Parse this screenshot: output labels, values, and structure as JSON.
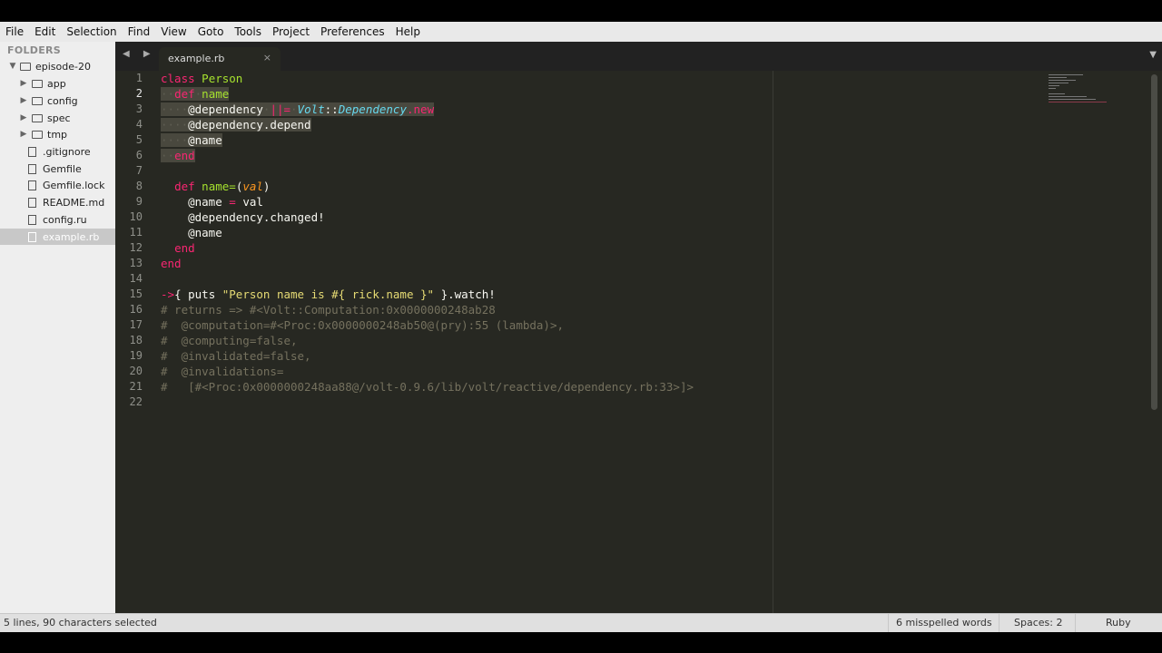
{
  "menu": [
    "File",
    "Edit",
    "Selection",
    "Find",
    "View",
    "Goto",
    "Tools",
    "Project",
    "Preferences",
    "Help"
  ],
  "sidebar": {
    "title": "FOLDERS",
    "root": "episode-20",
    "folders": [
      "app",
      "config",
      "spec",
      "tmp"
    ],
    "files": [
      ".gitignore",
      "Gemfile",
      "Gemfile.lock",
      "README.md",
      "config.ru",
      "example.rb"
    ],
    "selected_file": "example.rb"
  },
  "tab": {
    "name": "example.rb",
    "close": "×"
  },
  "tab_nav": "◀ ▶",
  "editor": {
    "line_numbers": [
      "1",
      "2",
      "3",
      "4",
      "5",
      "6",
      "7",
      "8",
      "9",
      "10",
      "11",
      "12",
      "13",
      "14",
      "15",
      "16",
      "17",
      "18",
      "19",
      "20",
      "21",
      "22"
    ],
    "current_line": "2",
    "line2_kw": "def",
    "line2_name": "name",
    "line3_ivar": "@dependency",
    "line3_op": "||=",
    "line3_cls1": "Volt",
    "line3_sep": "::",
    "line3_cls2": "Dependency",
    "line3_dot": ".",
    "line3_new": "new",
    "line4_code": "@dependency.depend",
    "line5_code": "@name",
    "line6_kw": "end",
    "line8_kw": "def",
    "line8_name": "name=",
    "line8_p1": "(",
    "line8_param": "val",
    "line8_p2": ")",
    "line9_ivar": "@name",
    "line9_op": "=",
    "line9_val": "val",
    "line10_code": "@dependency.changed!",
    "line11_code": "@name",
    "line12_kw": "end",
    "line13_kw": "end",
    "line15_arrow": "->",
    "line15_a": "{ puts ",
    "line15_str": "\"Person name is #{ rick.name }\"",
    "line15_b": " }.watch!",
    "line16": "# returns => #<Volt::Computation:0x0000000248ab28",
    "line17": "#  @computation=#<Proc:0x0000000248ab50@(pry):55 (lambda)>,",
    "line18": "#  @computing=false,",
    "line19": "#  @invalidated=false,",
    "line20": "#  @invalidations=",
    "line21": "#   [#<Proc:0x0000000248aa88@/volt-0.9.6/lib/volt/reactive/dependency.rb:33>]>"
  },
  "class_line": {
    "kw": "class",
    "name": "Person"
  },
  "status": {
    "selection": "5 lines, 90 characters selected",
    "spelling": "6 misspelled words",
    "indent": "Spaces: 2",
    "syntax": "Ruby"
  },
  "colors": {
    "keyword": "#f92672",
    "entity": "#a6e22e",
    "class": "#66d9ef",
    "string": "#e6db74",
    "comment": "#75715e",
    "param": "#fd971f",
    "background": "#272822"
  }
}
